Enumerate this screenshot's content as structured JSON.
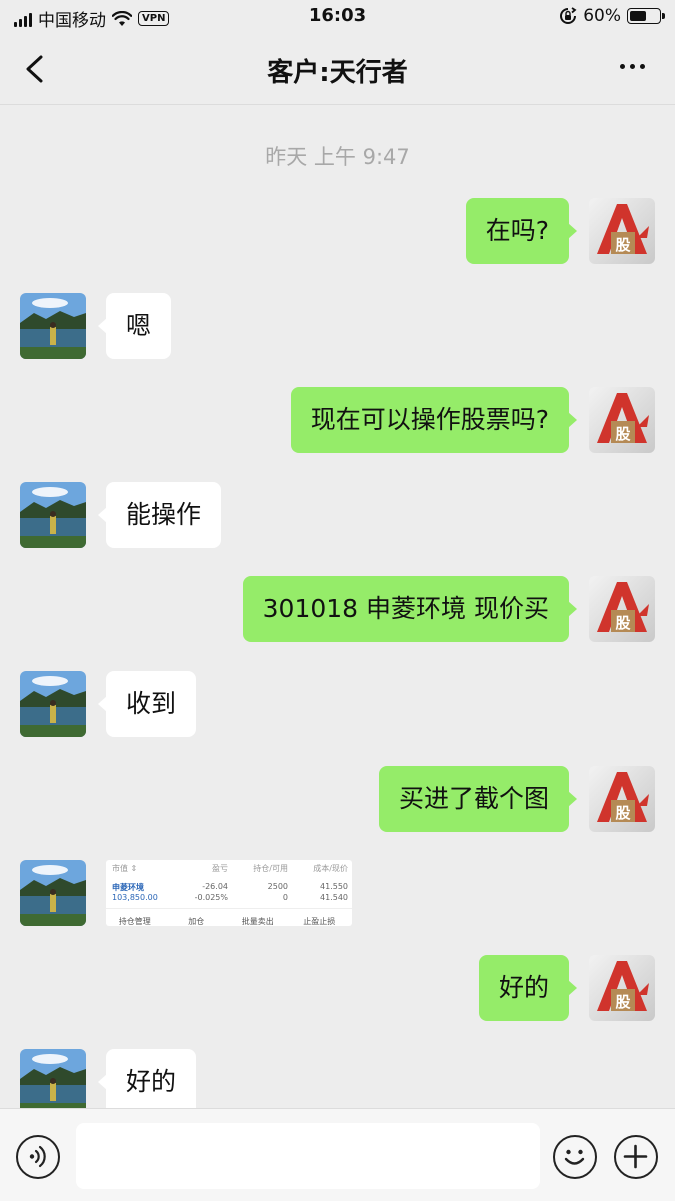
{
  "status_bar": {
    "carrier": "中国移动",
    "vpn": "VPN",
    "time": "16:03",
    "battery_percent_label": "60%",
    "battery_level": 0.6
  },
  "nav": {
    "title": "客户:天行者",
    "back_icon": "chevron-left-icon",
    "more_icon": "more-dots-icon"
  },
  "chat": {
    "timestamp": "昨天 上午 9:47",
    "messages": [
      {
        "side": "out",
        "text": "在吗?"
      },
      {
        "side": "in",
        "text": "嗯"
      },
      {
        "side": "out",
        "text": "现在可以操作股票吗?"
      },
      {
        "side": "in",
        "text": "能操作"
      },
      {
        "side": "out",
        "text": "301018 申菱环境 现价买"
      },
      {
        "side": "in",
        "text": "收到"
      },
      {
        "side": "out",
        "text": "买进了截个图"
      },
      {
        "side": "in",
        "type": "image"
      },
      {
        "side": "out",
        "text": "好的"
      },
      {
        "side": "in",
        "text": "好的"
      }
    ],
    "stock_image": {
      "headers": [
        "市值 ⇕",
        "盈亏",
        "持仓/可用",
        "成本/现价"
      ],
      "row1": [
        "申菱环境",
        "-26.04",
        "2500",
        "41.550"
      ],
      "row2": [
        "103,850.00",
        "-0.025%",
        "0",
        "41.540"
      ],
      "actions": [
        "持仓管理",
        "加仓",
        "批量卖出",
        "止盈止损"
      ]
    }
  },
  "input_bar": {
    "voice_icon": "voice-icon",
    "emoji_icon": "emoji-icon",
    "plus_icon": "plus-icon",
    "input_value": ""
  },
  "colors": {
    "background": "#ededed",
    "outgoing_bubble": "#95ec69",
    "incoming_bubble": "#ffffff",
    "timestamp": "#a8a8a8",
    "stock_accent": "#2a66b7"
  }
}
